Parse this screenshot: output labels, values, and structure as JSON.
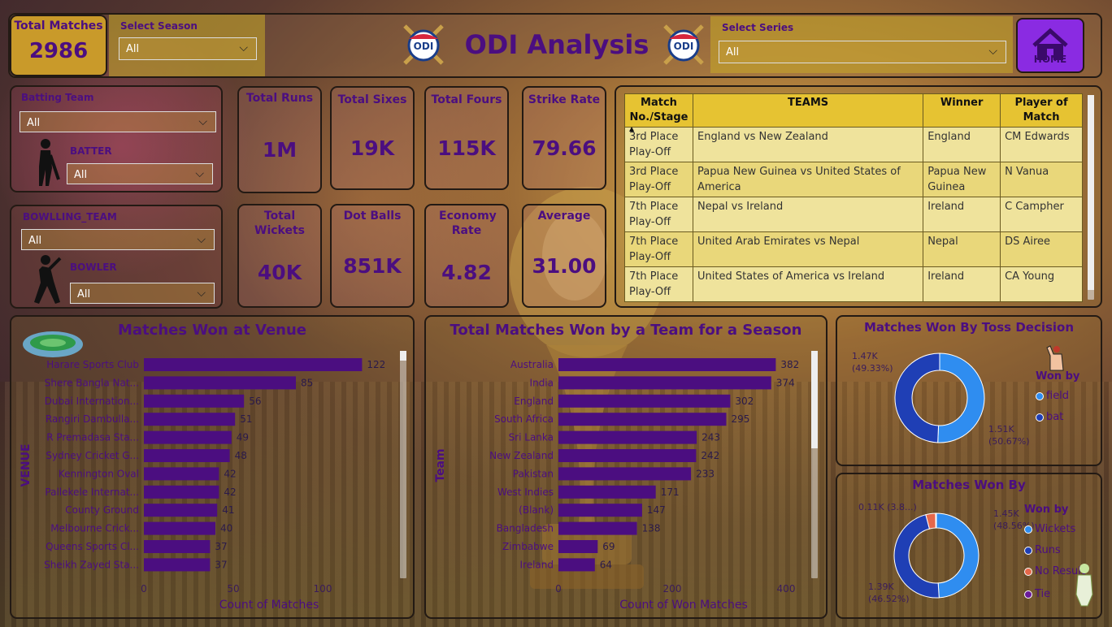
{
  "header": {
    "title": "ODI Analysis",
    "total_matches_label": "Total Matches",
    "total_matches_value": "2986",
    "season_label": "Select Season",
    "season_value": "All",
    "series_label": "Select Series",
    "series_value": "All",
    "home_label": "HOME",
    "logo_text": "ODI"
  },
  "filters": {
    "batting_team_label": "Batting Team",
    "batting_team_value": "All",
    "batter_label": "BATTER",
    "batter_value": "All",
    "bowling_team_label": "BOWLLING_TEAM",
    "bowling_team_value": "All",
    "bowler_label": "BOWLER",
    "bowler_value": "All"
  },
  "kpis": {
    "total_runs": {
      "label": "Total Runs",
      "value": "1M"
    },
    "total_sixes": {
      "label": "Total Sixes",
      "value": "19K"
    },
    "total_fours": {
      "label": "Total Fours",
      "value": "115K"
    },
    "strike_rate": {
      "label": "Strike Rate",
      "value": "79.66"
    },
    "total_wickets": {
      "label": "Total Wickets",
      "value": "40K"
    },
    "dot_balls": {
      "label": "Dot Balls",
      "value": "851K"
    },
    "economy_rate": {
      "label": "Economy Rate",
      "value": "4.82"
    },
    "average": {
      "label": "Average",
      "value": "31.00"
    }
  },
  "table": {
    "headers": [
      "Match No./Stage",
      "TEAMS",
      "Winner",
      "Player of Match"
    ],
    "rows": [
      [
        "3rd Place Play-Off",
        "England vs New Zealand",
        "England",
        "CM Edwards"
      ],
      [
        "3rd Place Play-Off",
        "Papua New Guinea vs United States of America",
        "Papua New Guinea",
        "N Vanua"
      ],
      [
        "7th Place Play-Off",
        "Nepal vs Ireland",
        "Ireland",
        "C Campher"
      ],
      [
        "7th Place Play-Off",
        "United Arab Emirates vs Nepal",
        "Nepal",
        "DS Airee"
      ],
      [
        "7th Place Play-Off",
        "United States of America vs Ireland",
        "Ireland",
        "CA Young"
      ]
    ]
  },
  "colors": {
    "purple": "#4b0e80",
    "gold": "#e6c332",
    "field": "#2f8df0",
    "bat": "#1f3fb5",
    "no_result": "#e5674a",
    "tie": "#6a1a9a"
  },
  "chart_data": [
    {
      "type": "bar",
      "title": "Matches Won at Venue",
      "xlabel": "Count of Matches",
      "ylabel": "VENUE",
      "xlim": [
        0,
        140
      ],
      "xticks": [
        0,
        50,
        100
      ],
      "categories": [
        "Harare Sports Club",
        "Shere Bangla Nat...",
        "Dubai Internation...",
        "Rangiri Dambulla...",
        "R Premadasa Sta...",
        "Sydney Cricket G...",
        "Kennington Oval",
        "Pallekele Internat...",
        "County Ground",
        "Melbourne Crick...",
        "Queens Sports Cl...",
        "Sheikh Zayed Sta..."
      ],
      "values": [
        122,
        85,
        56,
        51,
        49,
        48,
        42,
        42,
        41,
        40,
        37,
        37
      ]
    },
    {
      "type": "bar",
      "title": "Total Matches Won by a Team for a Season",
      "xlabel": "Count of Won Matches",
      "ylabel": "Team",
      "xlim": [
        0,
        440
      ],
      "xticks": [
        0,
        200,
        400
      ],
      "categories": [
        "Australia",
        "India",
        "England",
        "South Africa",
        "Sri Lanka",
        "New Zealand",
        "Pakistan",
        "West Indies",
        "(Blank)",
        "Bangladesh",
        "Zimbabwe",
        "Ireland"
      ],
      "values": [
        382,
        374,
        302,
        295,
        243,
        242,
        233,
        171,
        147,
        138,
        69,
        64
      ]
    },
    {
      "type": "pie",
      "title": "Matches Won By Toss Decision",
      "legend_title": "Won by",
      "labels": [
        "field",
        "bat"
      ],
      "values": [
        1510,
        1470
      ],
      "data_labels": [
        "1.51K (50.67%)",
        "1.47K (49.33%)"
      ]
    },
    {
      "type": "pie",
      "title": "Matches Won By",
      "legend_title": "Won by",
      "labels": [
        "Wickets",
        "Runs",
        "No Result",
        "Tie"
      ],
      "values": [
        1450,
        1390,
        110,
        10
      ],
      "data_labels": [
        "1.45K (48.56%)",
        "1.39K (46.52%)",
        "0.11K (3.8...)",
        ""
      ]
    }
  ]
}
